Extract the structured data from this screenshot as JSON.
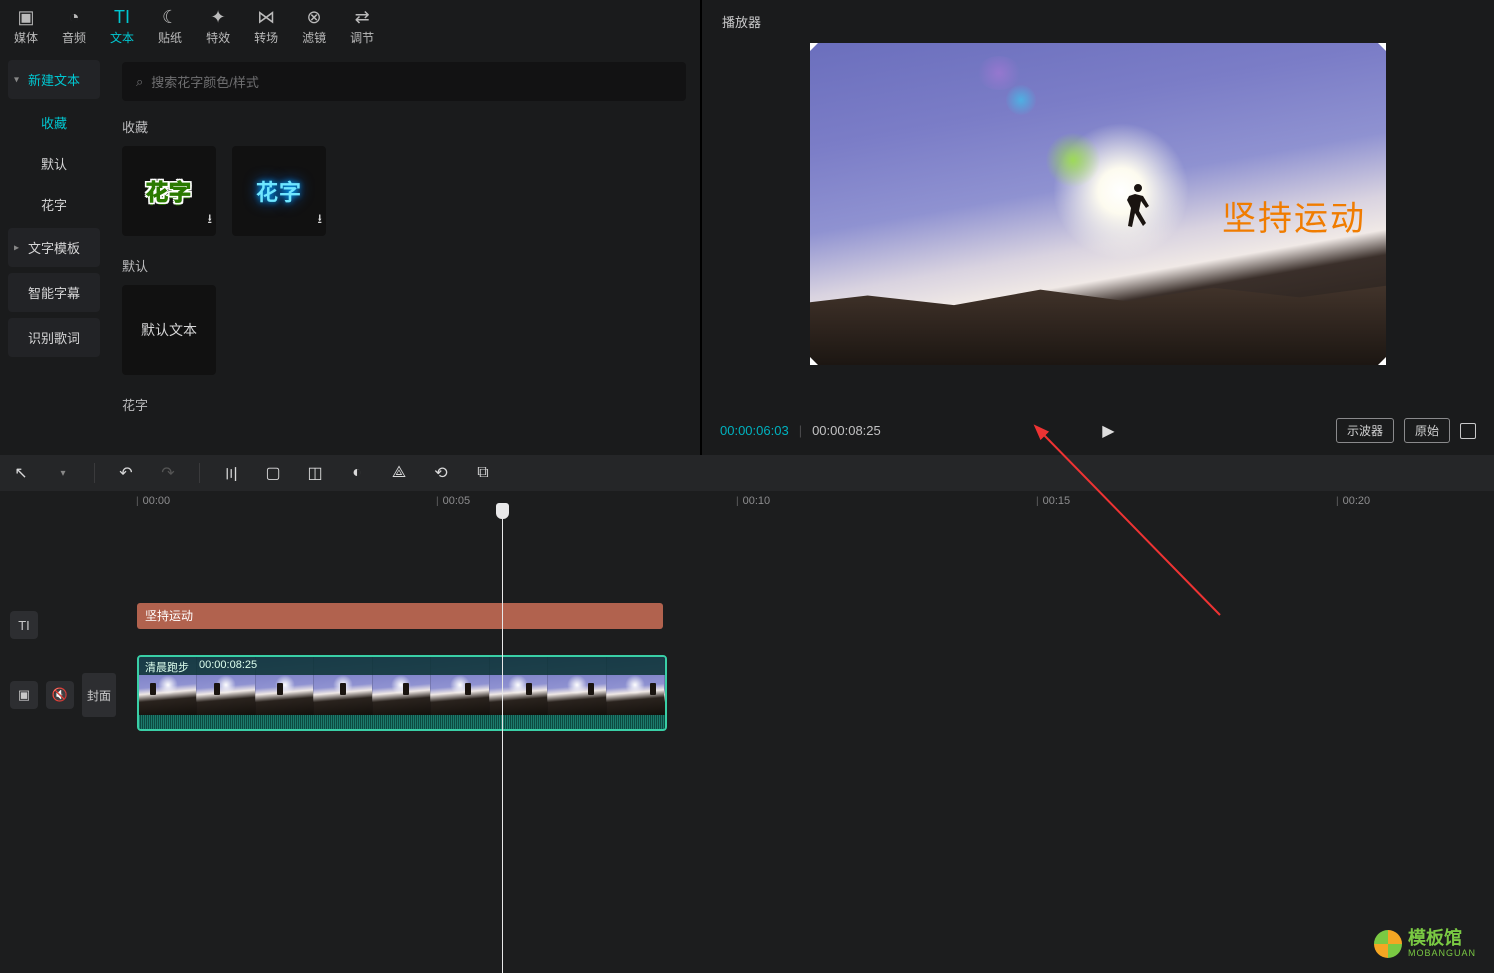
{
  "tabs": {
    "media": "媒体",
    "audio": "音频",
    "text": "文本",
    "sticker": "贴纸",
    "effect": "特效",
    "transition": "转场",
    "filter": "滤镜",
    "adjust": "调节"
  },
  "sidebar": {
    "new_text": "新建文本",
    "favorites": "收藏",
    "default": "默认",
    "flower": "花字",
    "templates": "文字模板",
    "smart_sub": "智能字幕",
    "recognize_lyrics": "识别歌词"
  },
  "search": {
    "placeholder": "搜索花字颜色/样式"
  },
  "sections": {
    "favorites": "收藏",
    "default": "默认",
    "flower": "花字"
  },
  "thumbs": {
    "flower_label": "花字",
    "default_text": "默认文本"
  },
  "player": {
    "title": "播放器",
    "overlay_text": "坚持运动",
    "current_time": "00:00:06:03",
    "total_time": "00:00:08:25",
    "scope": "示波器",
    "original": "原始"
  },
  "ruler": {
    "t0": "00:00",
    "t5": "00:05",
    "t10": "00:10",
    "t15": "00:15",
    "t20": "00:20"
  },
  "timeline": {
    "text_track_icon": "TI",
    "cover": "封面",
    "text_clip_label": "坚持运动",
    "video_clip_name": "清晨跑步",
    "video_clip_duration": "00:00:08:25"
  },
  "watermark": {
    "cn": "模板馆",
    "en": "MOBANGUAN"
  }
}
